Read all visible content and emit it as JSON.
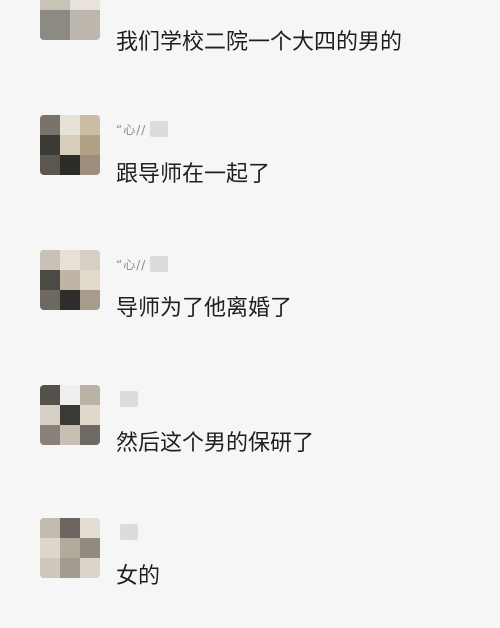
{
  "messages": [
    {
      "sender_nick": "",
      "text": "我们学校二院一个大四的男的"
    },
    {
      "sender_nick": "“心//",
      "text": "跟导师在一起了"
    },
    {
      "sender_nick": "“心//",
      "text": "导师为了他离婚了"
    },
    {
      "sender_nick": "",
      "text": "然后这个男的保研了"
    },
    {
      "sender_nick": "",
      "text": "女的"
    }
  ]
}
